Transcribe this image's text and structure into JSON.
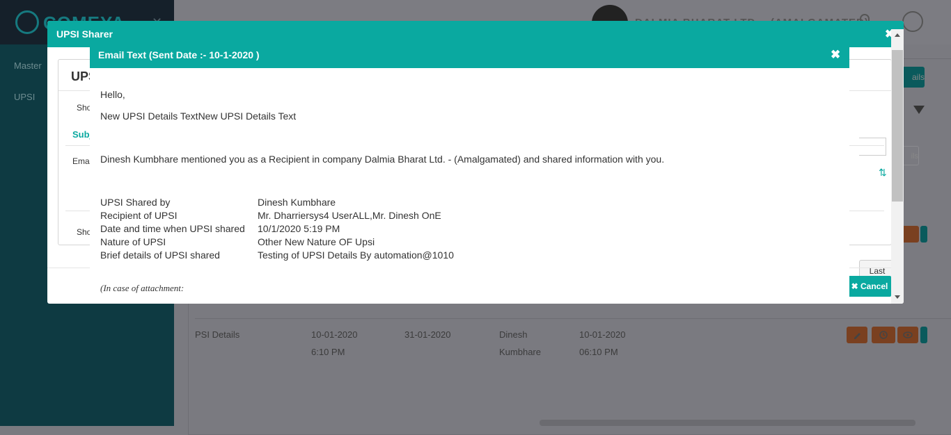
{
  "app": {
    "brand_name": "COMEYA",
    "sidebar_items": [
      "Master",
      "UPSI"
    ],
    "company_header": "DALMIA BHARAT LTD. - (AMALGAMATED)"
  },
  "background_table": {
    "row": {
      "name": "PSI Details",
      "date1": "10-01-2020",
      "time1": "6:10 PM",
      "date2": "31-01-2020",
      "owner_first": "Dinesh",
      "owner_last": "Kumbhare",
      "date3": "10-01-2020",
      "time3": "06:10 PM"
    },
    "details_button": "ails",
    "details_button2": "ils"
  },
  "outer_modal": {
    "title": "UPSI Sharer",
    "panel_title": "UPS",
    "show_label_top": "Sho",
    "subject_header": "Subj",
    "email_label": "Ema",
    "show_label_bottom": "Sho",
    "last_button": "Last",
    "cancel_button": "Cancel"
  },
  "email_modal": {
    "title": "Email Text (Sent Date :- 10-1-2020 )",
    "greeting": "Hello,",
    "details_text": "New UPSI Details TextNew UPSI Details Text",
    "mention_text": "Dinesh Kumbhare mentioned you as a Recipient in company Dalmia Bharat Ltd. - (Amalgamated) and shared information with you.",
    "details": [
      {
        "key": "UPSI Shared by",
        "value": "Dinesh Kumbhare"
      },
      {
        "key": "Recipient of UPSI",
        "value": "Mr. Dharriersys4 UserALL,Mr. Dinesh OnE"
      },
      {
        "key": "Date and time when UPSI shared",
        "value": "10/1/2020 5:19 PM"
      },
      {
        "key": "Nature of UPSI",
        "value": "Other New Nature OF Upsi"
      },
      {
        "key": "Brief details of UPSI shared",
        "value": "Testing of UPSI Details By automation@1010"
      }
    ],
    "attachment_note": "(In case of attachment:"
  },
  "colors": {
    "teal": "#0aa9a0",
    "sidebar": "#0e3a42",
    "overlay": "#7a7a80"
  }
}
